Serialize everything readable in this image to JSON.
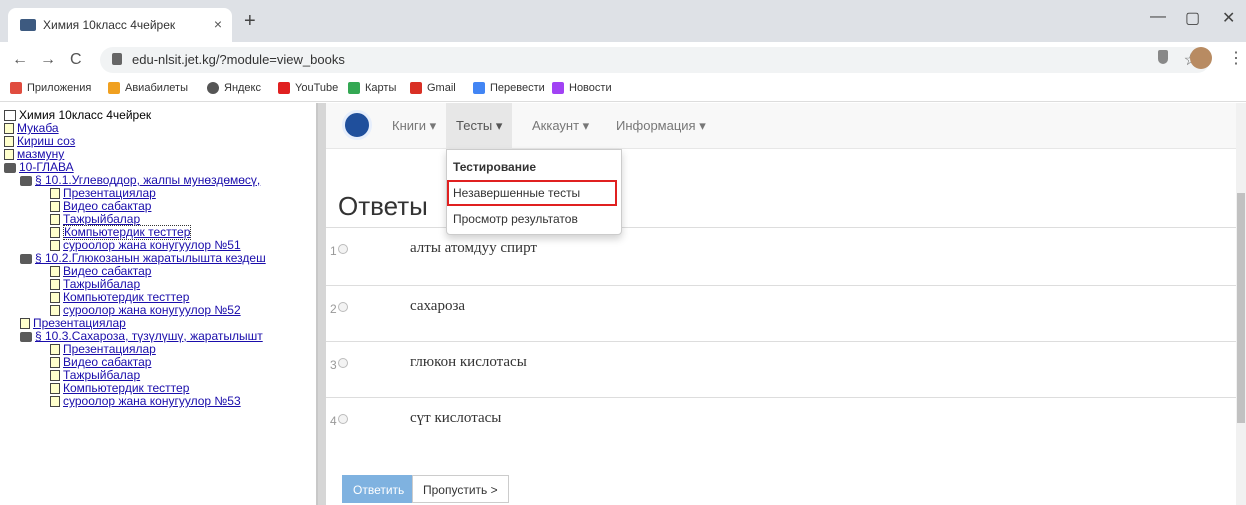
{
  "browser": {
    "tab_title": "Химия 10класс 4чейрек",
    "tab_close": "×",
    "new_tab": "+",
    "url": "edu-nlsit.jet.kg/?module=view_books",
    "back": "←",
    "forward": "→",
    "reload": "C",
    "star": "☆",
    "menu": "⋮",
    "minimize": "—",
    "restore": "▢",
    "close": "✕"
  },
  "bookmarks": [
    {
      "label": "Приложения",
      "icon": "apps-icon",
      "color": "#e04c3f"
    },
    {
      "label": "Авиабилеты",
      "icon": "plane-icon",
      "color": "#f0a020"
    },
    {
      "label": "Яндекс",
      "icon": "yandex-icon",
      "color": "#555555"
    },
    {
      "label": "YouTube",
      "icon": "youtube-icon",
      "color": "#e02020"
    },
    {
      "label": "Карты",
      "icon": "maps-icon",
      "color": "#34a853"
    },
    {
      "label": "Gmail",
      "icon": "gmail-icon",
      "color": "#d93025"
    },
    {
      "label": "Перевести",
      "icon": "translate-icon",
      "color": "#4285f4"
    },
    {
      "label": "Новости",
      "icon": "news-icon",
      "color": "#a142f4"
    }
  ],
  "tree": {
    "root": "Химия 10класс 4чейрек",
    "items": [
      {
        "label": "Мукаба",
        "icon": "doc",
        "level": 0
      },
      {
        "label": "Кириш соз",
        "icon": "doc",
        "level": 0
      },
      {
        "label": "мазмуну",
        "icon": "doc",
        "level": 0
      },
      {
        "label": "10-ГЛАВА",
        "icon": "book",
        "level": 0
      },
      {
        "label": "§ 10.1.Углеводдор, жалпы мунөздөмөсү,",
        "icon": "book",
        "level": 1
      },
      {
        "label": "Презентациялар",
        "icon": "doc",
        "level": 2
      },
      {
        "label": "Видео сабактар",
        "icon": "doc",
        "level": 2
      },
      {
        "label": "Тажрыйбалар",
        "icon": "doc",
        "level": 2
      },
      {
        "label": "Компьютердик тесттер",
        "icon": "doc",
        "level": 2,
        "selected": true
      },
      {
        "label": "суроолор жана конугуулор №51",
        "icon": "doc",
        "level": 2
      },
      {
        "label": "§ 10.2.Глюкозанын жаратылышта кездеш",
        "icon": "book",
        "level": 1
      },
      {
        "label": "Видео сабактар",
        "icon": "doc",
        "level": 2
      },
      {
        "label": "Тажрыйбалар",
        "icon": "doc",
        "level": 2
      },
      {
        "label": "Компьютердик тесттер",
        "icon": "doc",
        "level": 2
      },
      {
        "label": "суроолор жана конугуулор №52",
        "icon": "doc",
        "level": 2
      },
      {
        "label": "Презентациялар",
        "icon": "doc",
        "level": 1
      },
      {
        "label": "§ 10.3.Сахароза, түзүлүшү, жаратылышт",
        "icon": "book",
        "level": 1
      },
      {
        "label": "Презентациялар",
        "icon": "doc",
        "level": 2
      },
      {
        "label": "Видео сабактар",
        "icon": "doc",
        "level": 2
      },
      {
        "label": "Тажрыйбалар",
        "icon": "doc",
        "level": 2
      },
      {
        "label": "Компьютердик тесттер",
        "icon": "doc",
        "level": 2
      },
      {
        "label": "суроолор жана конугуулор №53",
        "icon": "doc",
        "level": 2
      }
    ]
  },
  "navbar": {
    "books": "Книги ▾",
    "tests": "Тесты ▾",
    "account": "Аккаунт ▾",
    "info": "Информация ▾"
  },
  "dropdown": {
    "header": "Тестирование",
    "incomplete": "Незавершенные тесты",
    "results": "Просмотр результатов"
  },
  "content": {
    "heading": "Ответы",
    "answers": [
      {
        "num": "1",
        "text": "алты атомдуу спирт"
      },
      {
        "num": "2",
        "text": "сахароза"
      },
      {
        "num": "3",
        "text": "глюкон кислотасы"
      },
      {
        "num": "4",
        "text": "сүт кислотасы"
      }
    ],
    "answer_button": "Ответить",
    "skip_button": "Пропустить >"
  }
}
